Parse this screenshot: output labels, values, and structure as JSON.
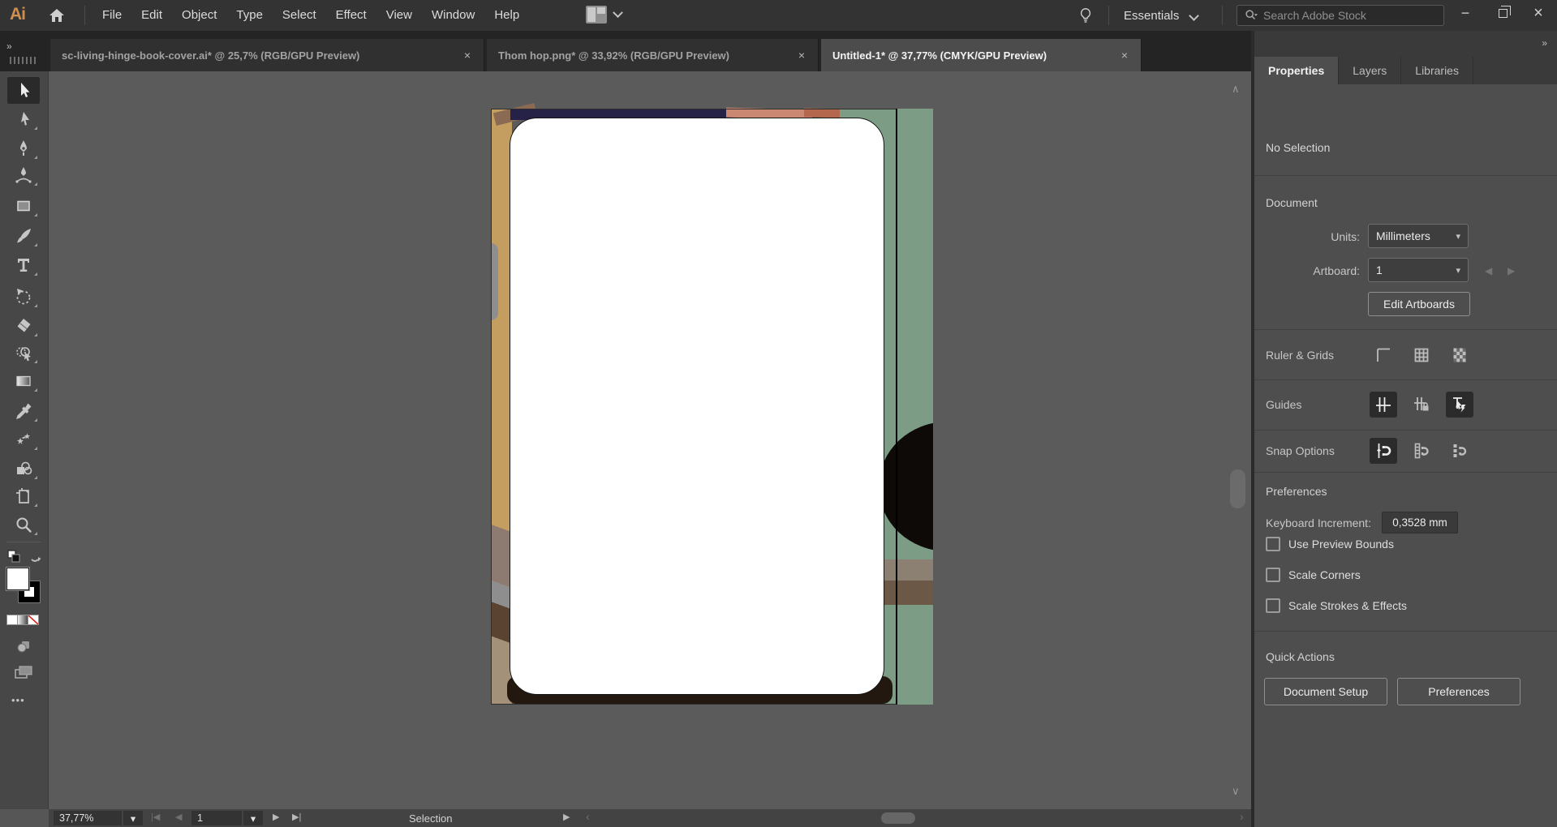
{
  "menubar": {
    "app_label": "Ai",
    "items": [
      "File",
      "Edit",
      "Object",
      "Type",
      "Select",
      "Effect",
      "View",
      "Window",
      "Help"
    ],
    "workspace": "Essentials",
    "search_placeholder": "Search Adobe Stock"
  },
  "tabs": [
    {
      "label": "sc-living-hinge-book-cover.ai* @ 25,7% (RGB/GPU Preview)",
      "active": false
    },
    {
      "label": "Thom hop.png* @ 33,92% (RGB/GPU Preview)",
      "active": false
    },
    {
      "label": "Untitled-1* @ 37,77% (CMYK/GPU Preview)",
      "active": true
    }
  ],
  "panel": {
    "tabs": [
      {
        "label": "Properties",
        "active": true
      },
      {
        "label": "Layers",
        "active": false
      },
      {
        "label": "Libraries",
        "active": false
      }
    ],
    "selection_status": "No Selection",
    "document": {
      "heading": "Document",
      "units_label": "Units:",
      "units_value": "Millimeters",
      "artboard_label": "Artboard:",
      "artboard_value": "1",
      "edit_artboards": "Edit Artboards"
    },
    "ruler_grids_label": "Ruler & Grids",
    "guides_label": "Guides",
    "snap_options_label": "Snap Options",
    "preferences": {
      "heading": "Preferences",
      "keyboard_increment_label": "Keyboard Increment:",
      "keyboard_increment_value": "0,3528 mm",
      "checkboxes": [
        "Use Preview Bounds",
        "Scale Corners",
        "Scale Strokes & Effects"
      ]
    },
    "quick_actions": {
      "heading": "Quick Actions",
      "buttons": [
        "Document Setup",
        "Preferences"
      ]
    }
  },
  "statusbar": {
    "zoom_level": "37,77%",
    "artboard_number": "1",
    "active_tool_label": "Selection"
  },
  "icons": {
    "close": "×",
    "chevron_down": "▾",
    "double_chevron": "»",
    "first": "|◀",
    "prev": "◀",
    "next": "▶",
    "last": "▶|",
    "play": "▶",
    "scroll_left": "‹",
    "scroll_right": "›",
    "scroll_up": "∧",
    "scroll_down": "∨",
    "minimize": "−",
    "ellipsis": "•••",
    "type_tool": "T"
  },
  "colors": {
    "tan": "#c49d60",
    "navy": "#262147",
    "brown": "#8a6a52",
    "salmon": "#ca8771",
    "salmon_dark": "#b5674e",
    "green": "#7d9c85",
    "ink": "#0d0a08",
    "shadow": "#231810",
    "card": "#ffffff",
    "pasteboard": "#5b5b5b"
  }
}
